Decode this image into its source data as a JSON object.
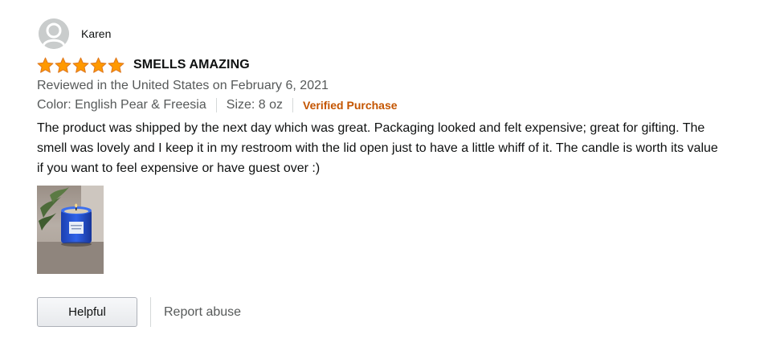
{
  "profile": {
    "name": "Karen",
    "avatar_icon": "user-silhouette-icon"
  },
  "review": {
    "rating": 5,
    "rating_max": 5,
    "star_color": "#ff9900",
    "title": "SMELLS AMAZING",
    "date": "Reviewed in the United States on February 6, 2021",
    "color": "Color: English Pear & Freesia",
    "size": "Size: 8 oz",
    "verified": "Verified Purchase",
    "verified_color": "#c45500",
    "body": "The product was shipped by the next day which was great. Packaging looked and felt expensive; great for gifting. The smell was lovely and I keep it in my restroom with the lid open just to have a little whiff of it. The candle is worth its value if you want to feel expensive or have guest over :)"
  },
  "actions": {
    "helpful_label": "Helpful",
    "report_label": "Report abuse"
  }
}
